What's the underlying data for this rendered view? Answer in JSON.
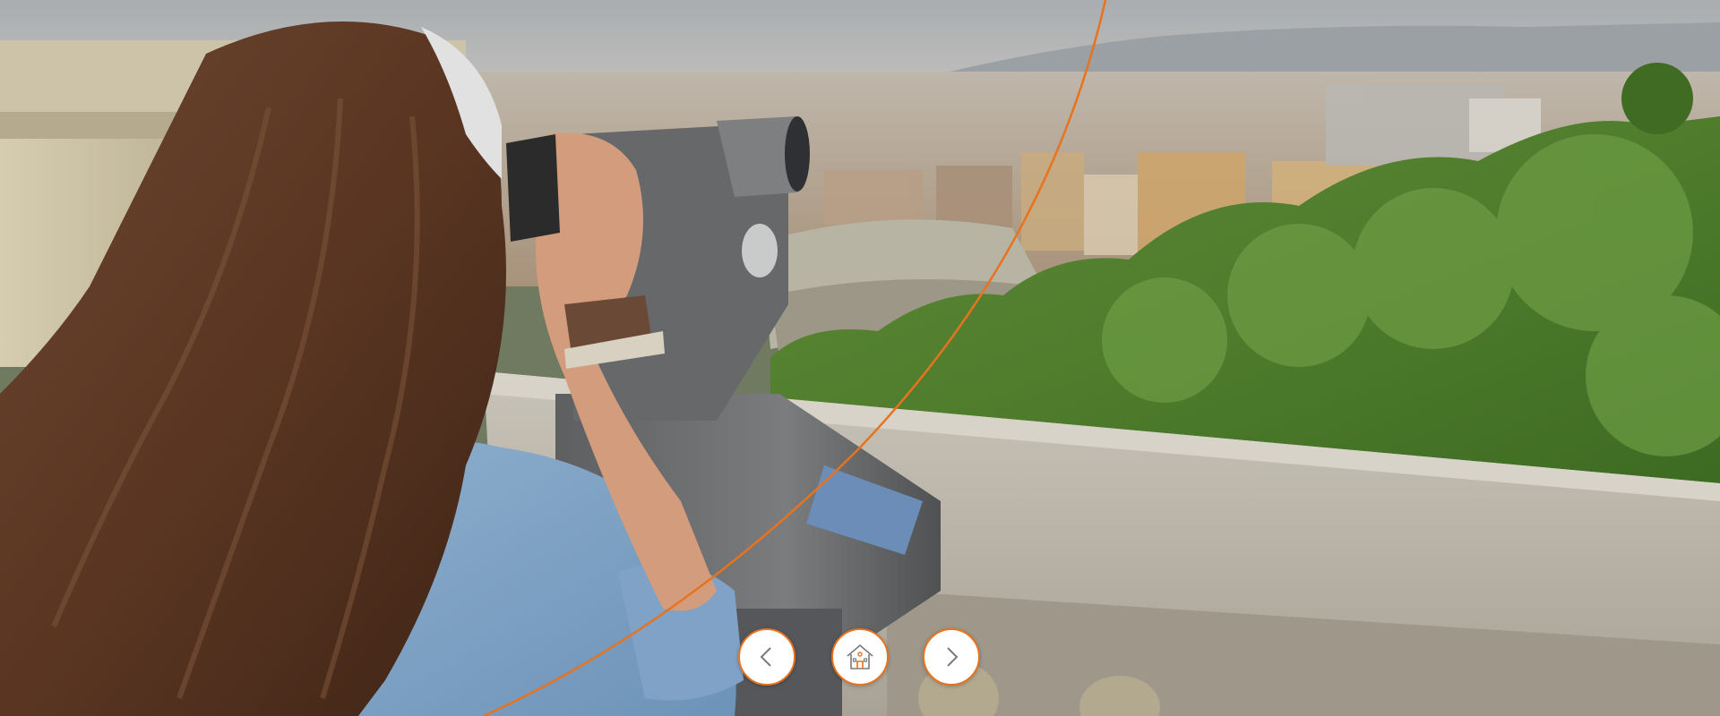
{
  "hero": {
    "image_description_icon": "woman-looking-through-coin-operated-binoculars-over-barcelona-icon"
  },
  "colors": {
    "accent": "#e8731f",
    "button_bg": "#ffffff"
  },
  "nav": {
    "prev_icon": "chevron-left-icon",
    "home_icon": "house-icon",
    "next_icon": "chevron-right-icon"
  }
}
